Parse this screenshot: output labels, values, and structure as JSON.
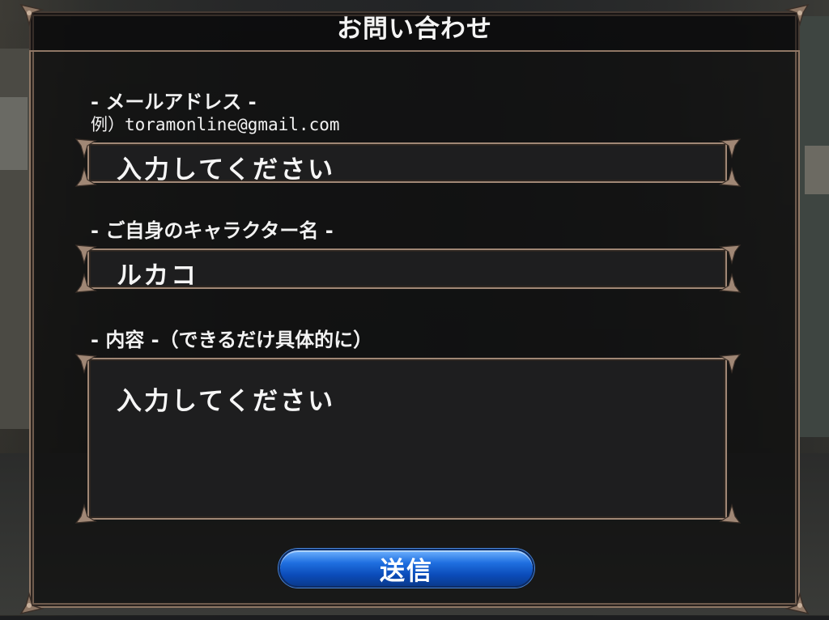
{
  "dialog": {
    "title": "お問い合わせ"
  },
  "email": {
    "label": "- メールアドレス -",
    "example": "例）toramonline@gmail.com",
    "placeholder": "入力してください"
  },
  "character": {
    "label": "- ご自身のキャラクター名 -",
    "value": "ルカコ"
  },
  "content": {
    "label": "- 内容 -（できるだけ具体的に）",
    "placeholder": "入力してください"
  },
  "actions": {
    "send_label": "送信"
  },
  "colors": {
    "frame": "#8f7765",
    "field_bg": "#1e1e1f",
    "button_blue": "#1f6fe0",
    "text": "#f4f4f4"
  }
}
